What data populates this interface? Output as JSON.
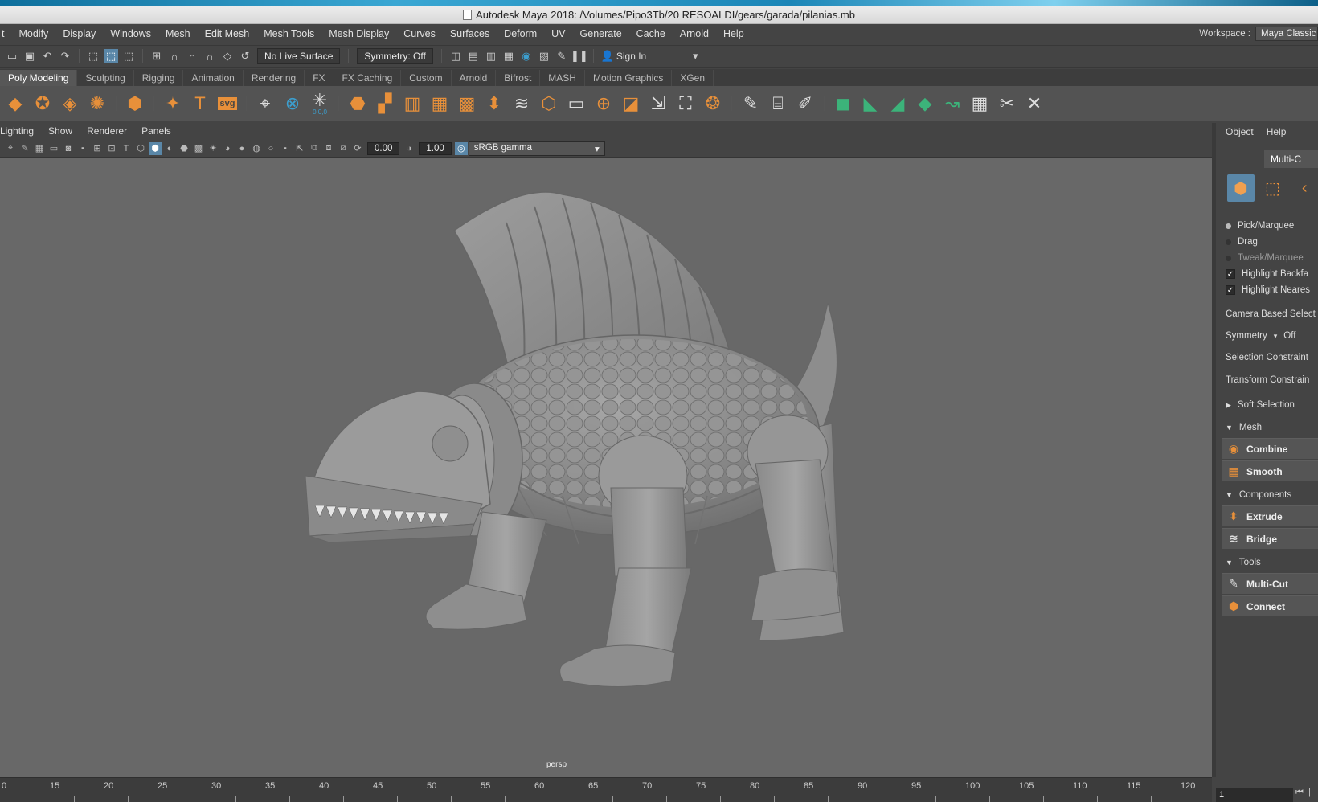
{
  "titlebar": {
    "title": "Autodesk Maya 2018: /Volumes/Pipo3Tb/20 RESOALDI/gears/garada/pilanias.mb"
  },
  "menubar": {
    "items": [
      "t",
      "Modify",
      "Display",
      "Windows",
      "Mesh",
      "Edit Mesh",
      "Mesh Tools",
      "Mesh Display",
      "Curves",
      "Surfaces",
      "Deform",
      "UV",
      "Generate",
      "Cache",
      "Arnold",
      "Help"
    ],
    "workspace_label": "Workspace :",
    "workspace_value": "Maya Classic"
  },
  "statusline": {
    "live_surface": "No Live Surface",
    "symmetry": "Symmetry: Off",
    "sign_in": "Sign In"
  },
  "shelf": {
    "tabs": [
      "Poly Modeling",
      "Sculpting",
      "Rigging",
      "Animation",
      "Rendering",
      "FX",
      "FX Caching",
      "Custom",
      "Arnold",
      "Bifrost",
      "MASH",
      "Motion Graphics",
      "XGen"
    ],
    "active_tab": "Poly Modeling",
    "svg_label": "svg",
    "coord_label": "0,0,0"
  },
  "viewport": {
    "menu": [
      "Lighting",
      "Show",
      "Renderer",
      "Panels"
    ],
    "exposure": "0.00",
    "gamma": "1.00",
    "color_space": "sRGB gamma",
    "camera_label": "persp",
    "background_color": "#686868"
  },
  "modeling_toolkit": {
    "tabs": [
      "Object",
      "Help"
    ],
    "header": "Multi-C",
    "selection_modes": [
      {
        "label": "Pick/Marquee",
        "dim": false
      },
      {
        "label": "Drag",
        "dim": false
      },
      {
        "label": "Tweak/Marquee",
        "dim": true
      }
    ],
    "checks": [
      "Highlight Backfa",
      "Highlight Neares"
    ],
    "camera_based": "Camera Based Select",
    "symmetry_label": "Symmetry",
    "symmetry_value": "Off",
    "selection_constraint": "Selection Constraint",
    "transform_constraint": "Transform Constrain",
    "soft_selection": "Soft Selection",
    "sections": {
      "mesh": {
        "title": "Mesh",
        "buttons": [
          "Combine",
          "Smooth"
        ]
      },
      "components": {
        "title": "Components",
        "buttons": [
          "Extrude",
          "Bridge"
        ]
      },
      "tools": {
        "title": "Tools",
        "buttons": [
          "Multi-Cut",
          "Connect"
        ]
      }
    }
  },
  "timeline": {
    "ticks": [
      "0",
      "15",
      "20",
      "25",
      "30",
      "35",
      "40",
      "45",
      "50",
      "55",
      "60",
      "65",
      "70",
      "75",
      "80",
      "85",
      "90",
      "95",
      "100",
      "105",
      "110",
      "115",
      "120"
    ],
    "current_frame": "1"
  },
  "colors": {
    "accent_orange": "#e8903a",
    "accent_blue": "#3c9fcf",
    "active_mode": "#5a87a8"
  }
}
